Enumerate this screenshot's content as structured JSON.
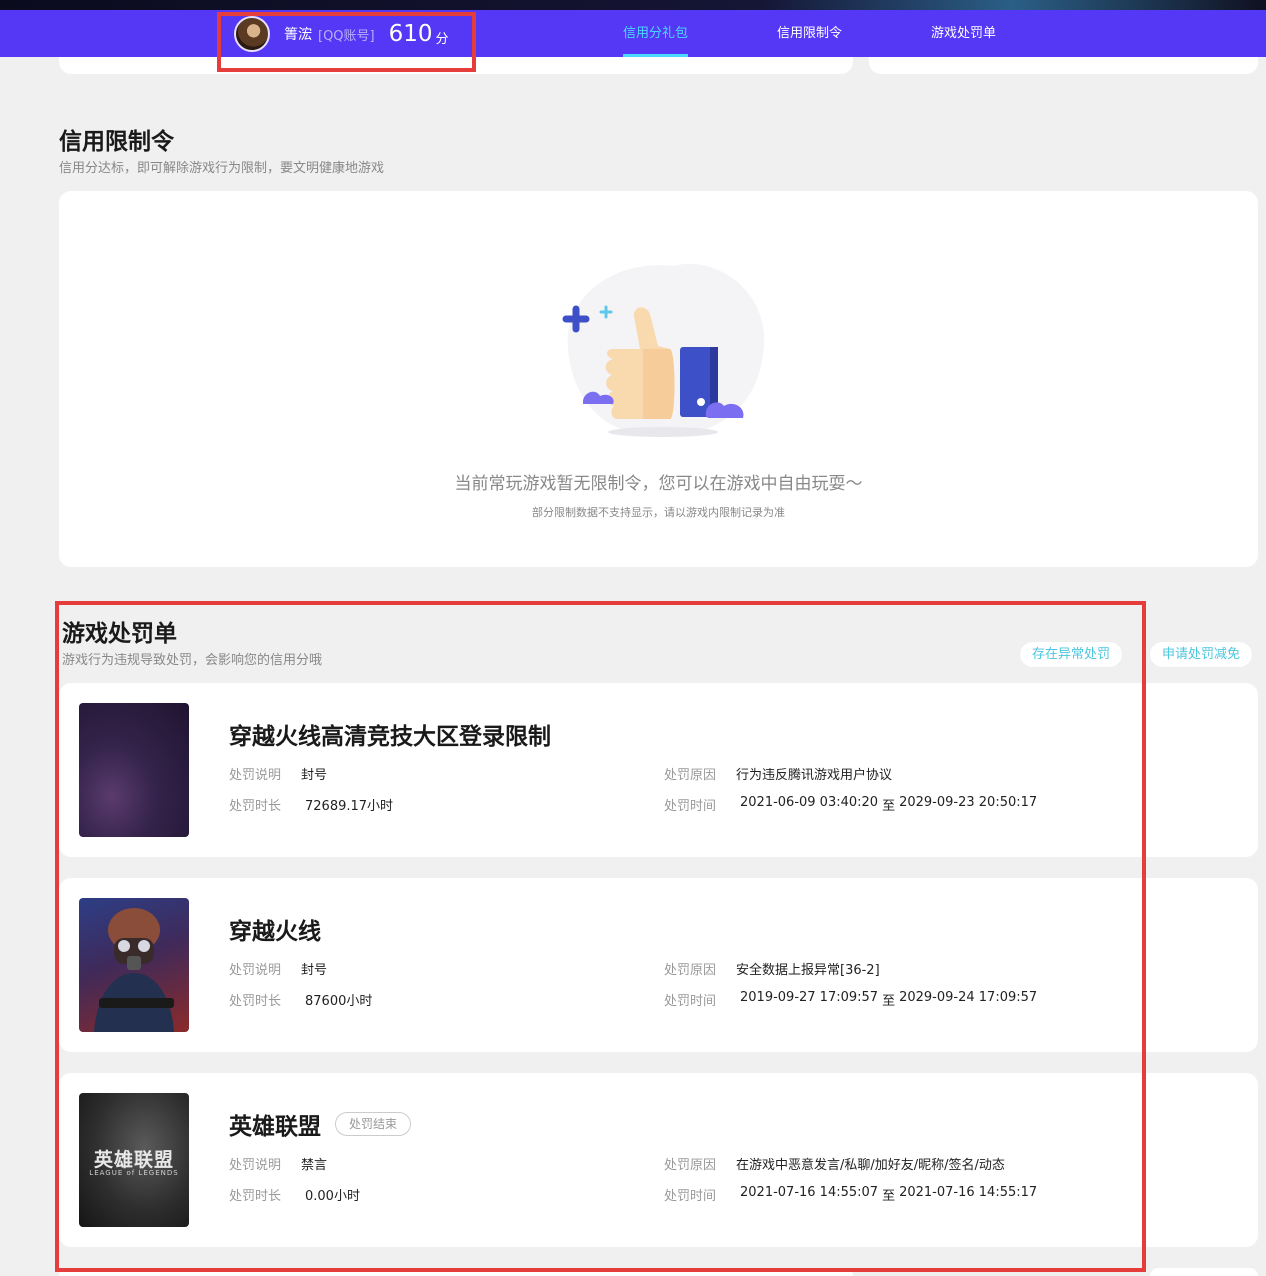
{
  "nav": {
    "nickname": "箐浤",
    "account_type": "[QQ账号]",
    "score": "610",
    "score_unit": "分",
    "tabs": [
      {
        "label": "信用分礼包",
        "active": true
      },
      {
        "label": "信用限制令",
        "active": false
      },
      {
        "label": "游戏处罚单",
        "active": false
      }
    ]
  },
  "restriction": {
    "title": "信用限制令",
    "subtitle": "信用分达标，即可解除游戏行为限制，要文明健康地游戏",
    "empty_text": "当前常玩游戏暂无限制令，您可以在游戏中自由玩耍～",
    "empty_note": "部分限制数据不支持显示，请以游戏内限制记录为准"
  },
  "penalty": {
    "title": "游戏处罚单",
    "subtitle": "游戏行为违规导致处罚，会影响您的信用分哦",
    "buttons": {
      "abnormal": "存在异常处罚",
      "reduce": "申请处罚减免"
    },
    "labels": {
      "desc": "处罚说明",
      "duration": "处罚时长",
      "reason": "处罚原因",
      "time": "处罚时间",
      "to": "至"
    },
    "items": [
      {
        "game": "穿越火线高清竞技大区登录限制",
        "status": "",
        "desc": "封号",
        "duration": "72689.17小时",
        "reason": "行为违反腾讯游戏用户协议",
        "time_start": "2021-06-09 03:40:20",
        "time_end": "2029-09-23 20:50:17"
      },
      {
        "game": "穿越火线",
        "status": "",
        "desc": "封号",
        "duration": "87600小时",
        "reason": "安全数据上报异常[36-2]",
        "time_start": "2019-09-27 17:09:57",
        "time_end": "2029-09-24 17:09:57"
      },
      {
        "game": "英雄联盟",
        "status": "处罚结束",
        "thumb_text": "英雄联盟",
        "thumb_sub": "LEAGUE of LEGENDS",
        "desc": "禁言",
        "duration": "0.00小时",
        "reason": "在游戏中恶意发言/私聊/加好友/昵称/签名/动态",
        "time_start": "2021-07-16 14:55:07",
        "time_end": "2021-07-16 14:55:17"
      }
    ]
  },
  "colors": {
    "nav_bg": "#5438f5",
    "accent": "#4ad9ff",
    "highlight_box": "#e53c3c",
    "link": "#4bc6e0"
  }
}
